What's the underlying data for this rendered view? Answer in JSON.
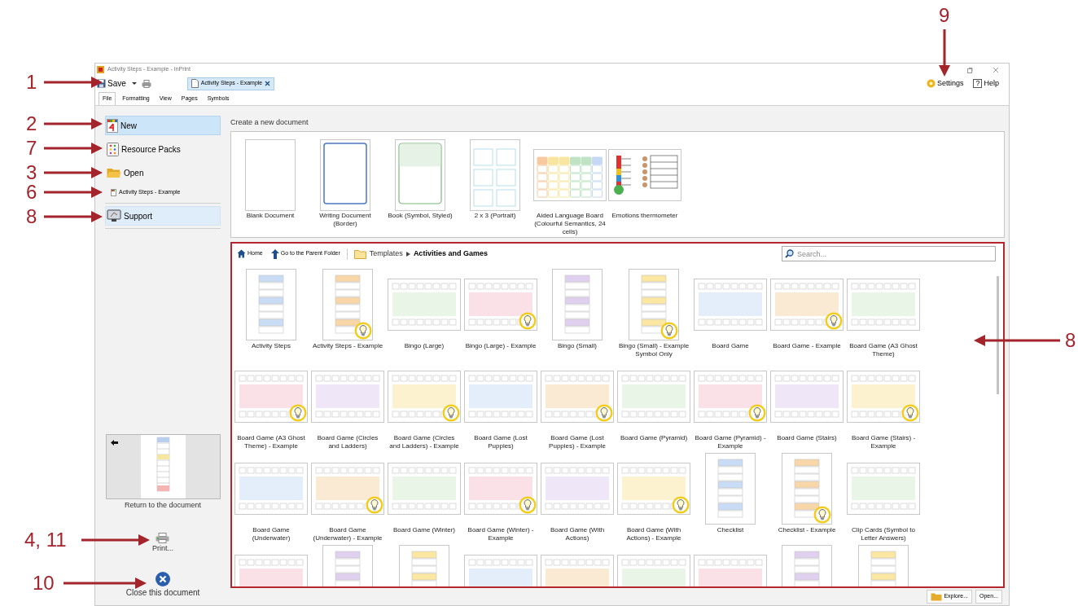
{
  "window": {
    "title": "Activity Steps - Example - InPrint"
  },
  "toolbar": {
    "save": "Save",
    "document_tab": "Activity Steps - Example",
    "settings": "Settings",
    "help_glyph": "?",
    "help": "Help"
  },
  "menu_tabs": [
    {
      "label": "File",
      "selected": true
    },
    {
      "label": "Formatting",
      "selected": false
    },
    {
      "label": "View",
      "selected": false
    },
    {
      "label": "Pages",
      "selected": false
    },
    {
      "label": "Symbols",
      "selected": false
    }
  ],
  "sidebar": {
    "items": [
      {
        "label": "New",
        "kind": "new",
        "selected": true
      },
      {
        "label": "Resource Packs",
        "kind": "packs",
        "selected": false
      },
      {
        "label": "Open",
        "kind": "open",
        "selected": false
      },
      {
        "label": "Activity Steps - Example",
        "kind": "recent",
        "selected": false
      }
    ],
    "support": "Support",
    "preview_label": "Return to the document",
    "print": "Print...",
    "close": "Close this document"
  },
  "create": {
    "heading": "Create a new document",
    "templates": [
      {
        "label": "Blank Document",
        "kind": "blank"
      },
      {
        "label": "Writing Document (Border)",
        "kind": "border"
      },
      {
        "label": "Book (Symbol, Styled)",
        "kind": "book"
      },
      {
        "label": "2 x 3 (Portrait)",
        "kind": "grid"
      },
      {
        "label": "Aided Language Board (Colourful Semantics, 24 cells)",
        "kind": "board"
      },
      {
        "label": "Emotions thermometer",
        "kind": "thermometer"
      }
    ]
  },
  "browser": {
    "home": "Home",
    "parent": "Go to the Parent Folder",
    "folder": "Templates",
    "current": "Activities and Games",
    "search": {
      "placeholder": "Search..."
    },
    "items": [
      {
        "label": "Activity Steps",
        "kind": "portrait",
        "example": false
      },
      {
        "label": "Activity Steps - Example",
        "kind": "portrait",
        "example": true
      },
      {
        "label": "Bingo (Large)",
        "kind": "landscape",
        "example": false
      },
      {
        "label": "Bingo (Large) - Example",
        "kind": "landscape",
        "example": true
      },
      {
        "label": "Bingo (Small)",
        "kind": "portrait",
        "example": false
      },
      {
        "label": "Bingo (Small) - Example Symbol Only",
        "kind": "portrait",
        "example": true
      },
      {
        "label": "Board Game",
        "kind": "landscape",
        "example": false
      },
      {
        "label": "Board Game - Example",
        "kind": "landscape",
        "example": true
      },
      {
        "label": "Board Game (A3 Ghost Theme)",
        "kind": "landscape",
        "example": false
      },
      {
        "label": "Board Game (A3 Ghost Theme) - Example",
        "kind": "landscape",
        "example": true
      },
      {
        "label": "Board Game (Circles and Ladders)",
        "kind": "landscape",
        "example": false
      },
      {
        "label": "Board Game (Circles and Ladders) - Example",
        "kind": "landscape",
        "example": true
      },
      {
        "label": "Board Game (Lost Puppies)",
        "kind": "landscape",
        "example": false
      },
      {
        "label": "Board Game (Lost Puppies) - Example",
        "kind": "landscape",
        "example": true
      },
      {
        "label": "Board Game (Pyramid)",
        "kind": "landscape",
        "example": false
      },
      {
        "label": "Board Game (Pyramid) - Example",
        "kind": "landscape",
        "example": true
      },
      {
        "label": "Board Game (Stairs)",
        "kind": "landscape",
        "example": false
      },
      {
        "label": "Board Game (Stairs) - Example",
        "kind": "landscape",
        "example": true
      },
      {
        "label": "Board Game (Underwater)",
        "kind": "landscape",
        "example": false
      },
      {
        "label": "Board Game (Underwater) - Example",
        "kind": "landscape",
        "example": true
      },
      {
        "label": "Board Game (Winter)",
        "kind": "landscape",
        "example": false
      },
      {
        "label": "Board Game (Winter) - Example",
        "kind": "landscape",
        "example": true
      },
      {
        "label": "Board Game (With Actions)",
        "kind": "landscape",
        "example": false
      },
      {
        "label": "Board Game (With Actions) - Example",
        "kind": "landscape",
        "example": true
      },
      {
        "label": "Checklist",
        "kind": "portrait",
        "example": false
      },
      {
        "label": "Checklist - Example",
        "kind": "portrait",
        "example": true
      },
      {
        "label": "Clip Cards (Symbol to Letter Answers)",
        "kind": "landscape",
        "example": false
      },
      {
        "kind": "landscape"
      },
      {
        "kind": "portrait"
      },
      {
        "kind": "portrait"
      },
      {
        "kind": "landscape"
      },
      {
        "kind": "landscape"
      },
      {
        "kind": "landscape"
      },
      {
        "kind": "landscape"
      },
      {
        "kind": "portrait"
      },
      {
        "kind": "portrait"
      }
    ]
  },
  "buttons": [
    "Explore...",
    "Open..."
  ],
  "callouts": [
    {
      "label": "1"
    },
    {
      "label": "2"
    },
    {
      "label": "7"
    },
    {
      "label": "3"
    },
    {
      "label": "6"
    },
    {
      "label": "8"
    },
    {
      "label": "4, 11"
    },
    {
      "label": "10"
    },
    {
      "label": "9"
    },
    {
      "label": "8"
    }
  ]
}
